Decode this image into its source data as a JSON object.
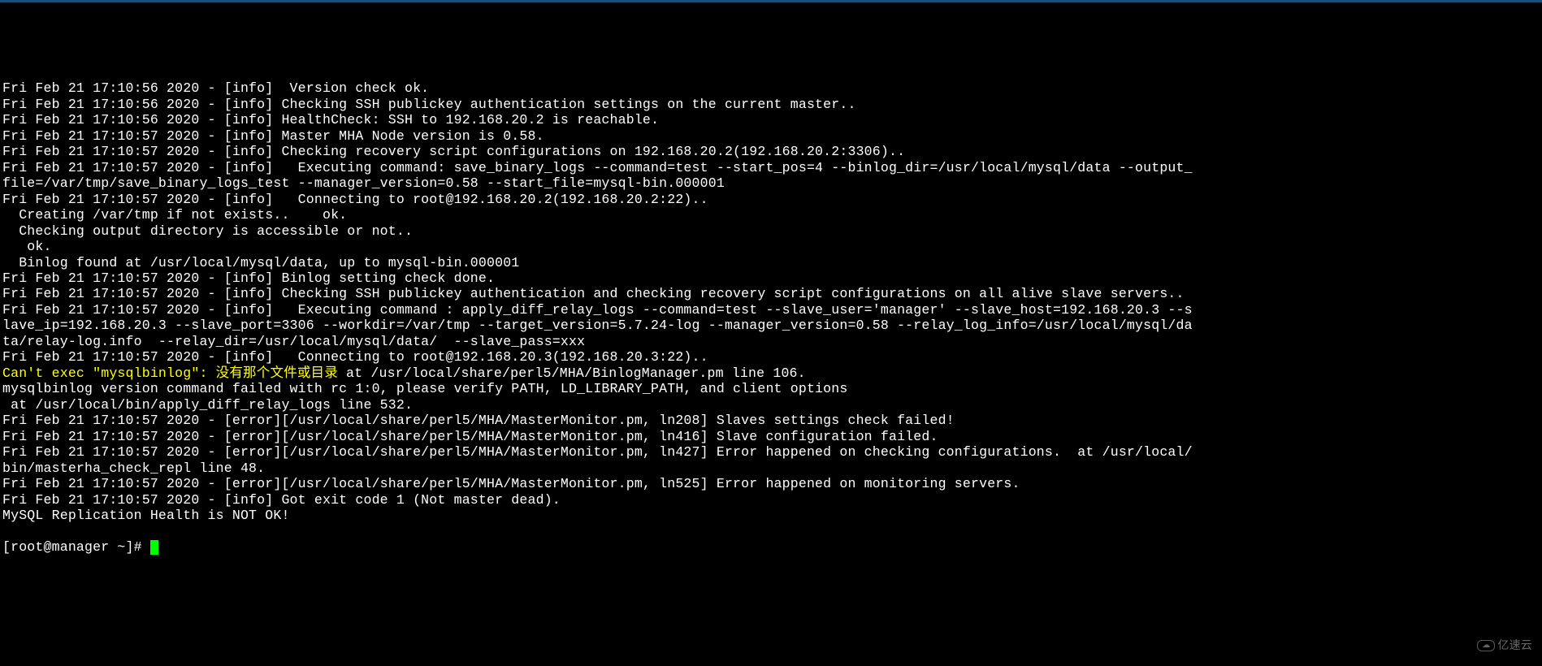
{
  "terminal": {
    "lines": [
      {
        "text": "Fri Feb 21 17:10:56 2020 - [info]  Version check ok.",
        "color": "white"
      },
      {
        "text": "Fri Feb 21 17:10:56 2020 - [info] Checking SSH publickey authentication settings on the current master..",
        "color": "white"
      },
      {
        "text": "Fri Feb 21 17:10:56 2020 - [info] HealthCheck: SSH to 192.168.20.2 is reachable.",
        "color": "white"
      },
      {
        "text": "Fri Feb 21 17:10:57 2020 - [info] Master MHA Node version is 0.58.",
        "color": "white"
      },
      {
        "text": "Fri Feb 21 17:10:57 2020 - [info] Checking recovery script configurations on 192.168.20.2(192.168.20.2:3306)..",
        "color": "white"
      },
      {
        "text": "Fri Feb 21 17:10:57 2020 - [info]   Executing command: save_binary_logs --command=test --start_pos=4 --binlog_dir=/usr/local/mysql/data --output_",
        "color": "white"
      },
      {
        "text": "file=/var/tmp/save_binary_logs_test --manager_version=0.58 --start_file=mysql-bin.000001",
        "color": "white"
      },
      {
        "text": "Fri Feb 21 17:10:57 2020 - [info]   Connecting to root@192.168.20.2(192.168.20.2:22).. ",
        "color": "white"
      },
      {
        "text": "  Creating /var/tmp if not exists..    ok.",
        "color": "white"
      },
      {
        "text": "  Checking output directory is accessible or not..",
        "color": "white"
      },
      {
        "text": "   ok.",
        "color": "white"
      },
      {
        "text": "  Binlog found at /usr/local/mysql/data, up to mysql-bin.000001",
        "color": "white"
      },
      {
        "text": "Fri Feb 21 17:10:57 2020 - [info] Binlog setting check done.",
        "color": "white"
      },
      {
        "text": "Fri Feb 21 17:10:57 2020 - [info] Checking SSH publickey authentication and checking recovery script configurations on all alive slave servers..",
        "color": "white"
      },
      {
        "text": "Fri Feb 21 17:10:57 2020 - [info]   Executing command : apply_diff_relay_logs --command=test --slave_user='manager' --slave_host=192.168.20.3 --s",
        "color": "white"
      },
      {
        "text": "lave_ip=192.168.20.3 --slave_port=3306 --workdir=/var/tmp --target_version=5.7.24-log --manager_version=0.58 --relay_log_info=/usr/local/mysql/da",
        "color": "white"
      },
      {
        "text": "ta/relay-log.info  --relay_dir=/usr/local/mysql/data/  --slave_pass=xxx",
        "color": "white"
      },
      {
        "text": "Fri Feb 21 17:10:57 2020 - [info]   Connecting to root@192.168.20.3(192.168.20.3:22).. ",
        "color": "white"
      },
      {
        "parts": [
          {
            "text": "Can't exec \"mysqlbinlog\": 没有那个文件或目录",
            "color": "yellow"
          },
          {
            "text": " at /usr/local/share/perl5/MHA/BinlogManager.pm line 106.",
            "color": "white"
          }
        ]
      },
      {
        "text": "mysqlbinlog version command failed with rc 1:0, please verify PATH, LD_LIBRARY_PATH, and client options",
        "color": "white"
      },
      {
        "text": " at /usr/local/bin/apply_diff_relay_logs line 532.",
        "color": "white"
      },
      {
        "text": "Fri Feb 21 17:10:57 2020 - [error][/usr/local/share/perl5/MHA/MasterMonitor.pm, ln208] Slaves settings check failed!",
        "color": "white"
      },
      {
        "text": "Fri Feb 21 17:10:57 2020 - [error][/usr/local/share/perl5/MHA/MasterMonitor.pm, ln416] Slave configuration failed.",
        "color": "white"
      },
      {
        "text": "Fri Feb 21 17:10:57 2020 - [error][/usr/local/share/perl5/MHA/MasterMonitor.pm, ln427] Error happened on checking configurations.  at /usr/local/",
        "color": "white"
      },
      {
        "text": "bin/masterha_check_repl line 48.",
        "color": "white"
      },
      {
        "text": "Fri Feb 21 17:10:57 2020 - [error][/usr/local/share/perl5/MHA/MasterMonitor.pm, ln525] Error happened on monitoring servers.",
        "color": "white"
      },
      {
        "text": "Fri Feb 21 17:10:57 2020 - [info] Got exit code 1 (Not master dead).",
        "color": "white"
      },
      {
        "text": "",
        "color": "white"
      },
      {
        "text": "MySQL Replication Health is NOT OK!",
        "color": "white"
      }
    ],
    "prompt": "[root@manager ~]# ",
    "watermark": "亿速云"
  }
}
